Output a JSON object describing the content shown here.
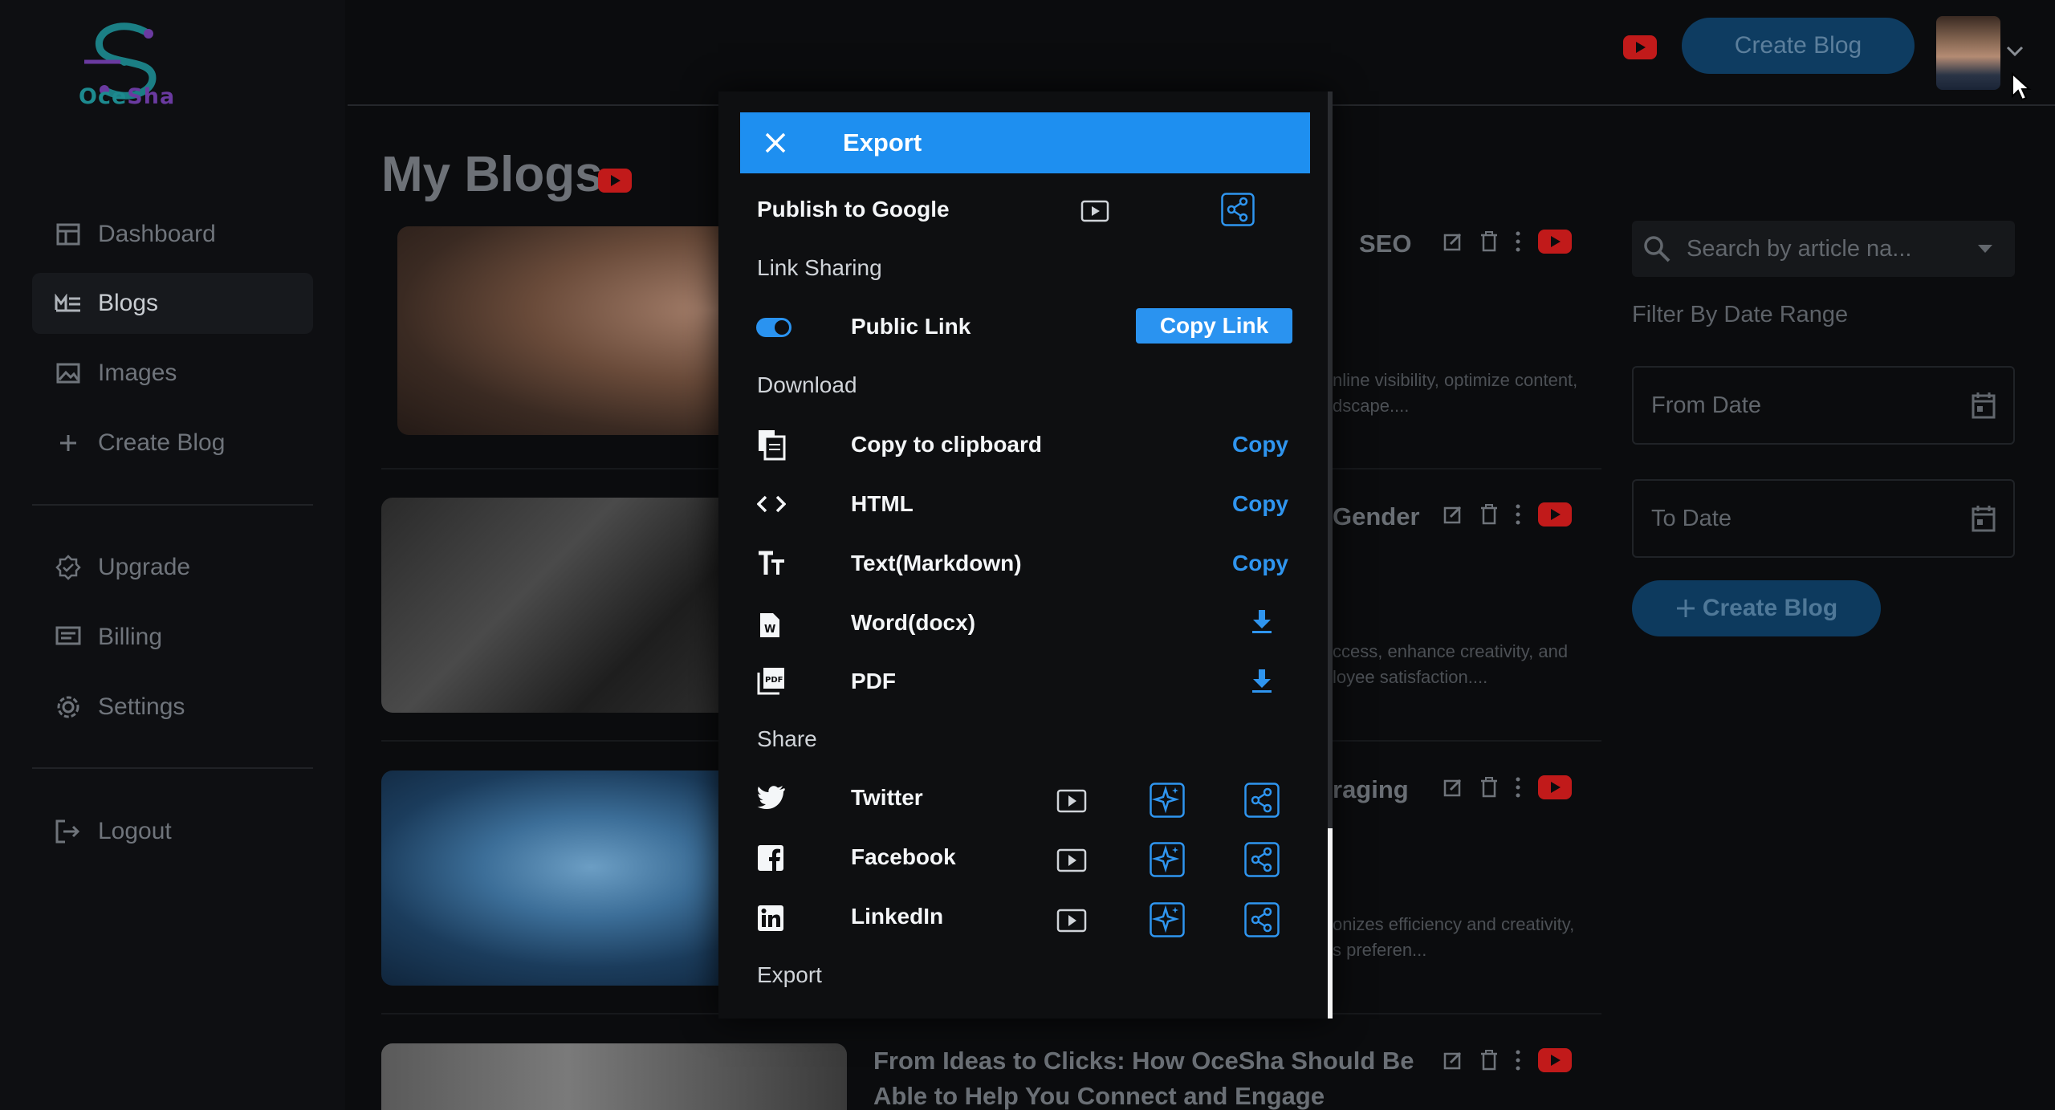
{
  "brand": {
    "logo_text_a": "Oce",
    "logo_text_b": "Sha"
  },
  "sidebar": {
    "items": [
      {
        "label": "Dashboard",
        "icon": "dashboard-icon"
      },
      {
        "label": "Blogs",
        "icon": "blogs-icon",
        "active": true
      },
      {
        "label": "Images",
        "icon": "images-icon"
      },
      {
        "label": "Create Blog",
        "icon": "plus-icon"
      },
      {
        "label": "Upgrade",
        "icon": "upgrade-icon"
      },
      {
        "label": "Billing",
        "icon": "billing-icon"
      },
      {
        "label": "Settings",
        "icon": "settings-icon"
      },
      {
        "label": "Logout",
        "icon": "logout-icon"
      }
    ]
  },
  "header": {
    "create_blog_label": "Create Blog"
  },
  "main": {
    "title": "My Blogs",
    "cards": [
      {
        "title_visible": "SEO",
        "desc_line1": "nline visibility, optimize content,",
        "desc_line2": "dscape...."
      },
      {
        "title_visible": "Gender",
        "desc_line1": "ccess, enhance creativity, and",
        "desc_line2": "loyee satisfaction...."
      },
      {
        "title_visible": "raging",
        "desc_line1": "onizes efficiency and creativity,",
        "desc_line2": "s preferen..."
      },
      {
        "title_visible": "From Ideas to Clicks: How OceSha Should Be Able to Help You Connect and Engage"
      }
    ]
  },
  "filters": {
    "search_placeholder": "Search by article na...",
    "date_range_label": "Filter By Date Range",
    "from_date": "From Date",
    "to_date": "To Date",
    "create_blog_label": "Create Blog"
  },
  "modal": {
    "title": "Export",
    "publish_google": "Publish to Google",
    "link_sharing": "Link Sharing",
    "public_link": "Public Link",
    "copy_link": "Copy Link",
    "download": "Download",
    "copy_clipboard": "Copy to clipboard",
    "html": "HTML",
    "markdown": "Text(Markdown)",
    "word": "Word(docx)",
    "pdf": "PDF",
    "copy": "Copy",
    "share": "Share",
    "twitter": "Twitter",
    "facebook": "Facebook",
    "linkedin": "LinkedIn",
    "export_footer": "Export"
  },
  "colors": {
    "accent": "#1e8ff0",
    "youtube": "#e01f1f"
  }
}
